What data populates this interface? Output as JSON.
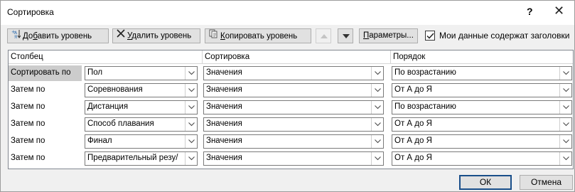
{
  "window": {
    "title": "Сортировка",
    "help": "?",
    "close": "✕"
  },
  "toolbar": {
    "add_level_pre": "До",
    "add_level_u": "б",
    "add_level_post": "авить уровень",
    "delete_level_u": "У",
    "delete_level_post": "далить уровень",
    "copy_level_u": "К",
    "copy_level_post": "опировать уровень",
    "options_u": "П",
    "options_post": "араметры...",
    "has_headers_label": "Мои данные содержат заголовки",
    "has_headers_checked": true
  },
  "grid": {
    "headers": {
      "column": "Столбец",
      "sort_on": "Сортировка",
      "order": "Порядок"
    },
    "rows": [
      {
        "label": "Сортировать по",
        "column": "Пол",
        "sort_on": "Значения",
        "order": "По возрастанию"
      },
      {
        "label": "Затем по",
        "column": "Соревнования",
        "sort_on": "Значения",
        "order": "От А до Я"
      },
      {
        "label": "Затем по",
        "column": "Дистанция",
        "sort_on": "Значения",
        "order": "По возрастанию"
      },
      {
        "label": "Затем по",
        "column": "Способ плавания",
        "sort_on": "Значения",
        "order": "От А до Я"
      },
      {
        "label": "Затем по",
        "column": "Финал",
        "sort_on": "Значения",
        "order": "От А до Я"
      },
      {
        "label": "Затем по",
        "column": "Предварительный резу/",
        "sort_on": "Значения",
        "order": "От А до Я"
      }
    ]
  },
  "footer": {
    "ok": "ОК",
    "cancel": "Отмена"
  },
  "colors": {
    "accent": "#1a4f8a",
    "selected_row": "#cccccc",
    "dialog_bg": "#f0f0f0"
  }
}
